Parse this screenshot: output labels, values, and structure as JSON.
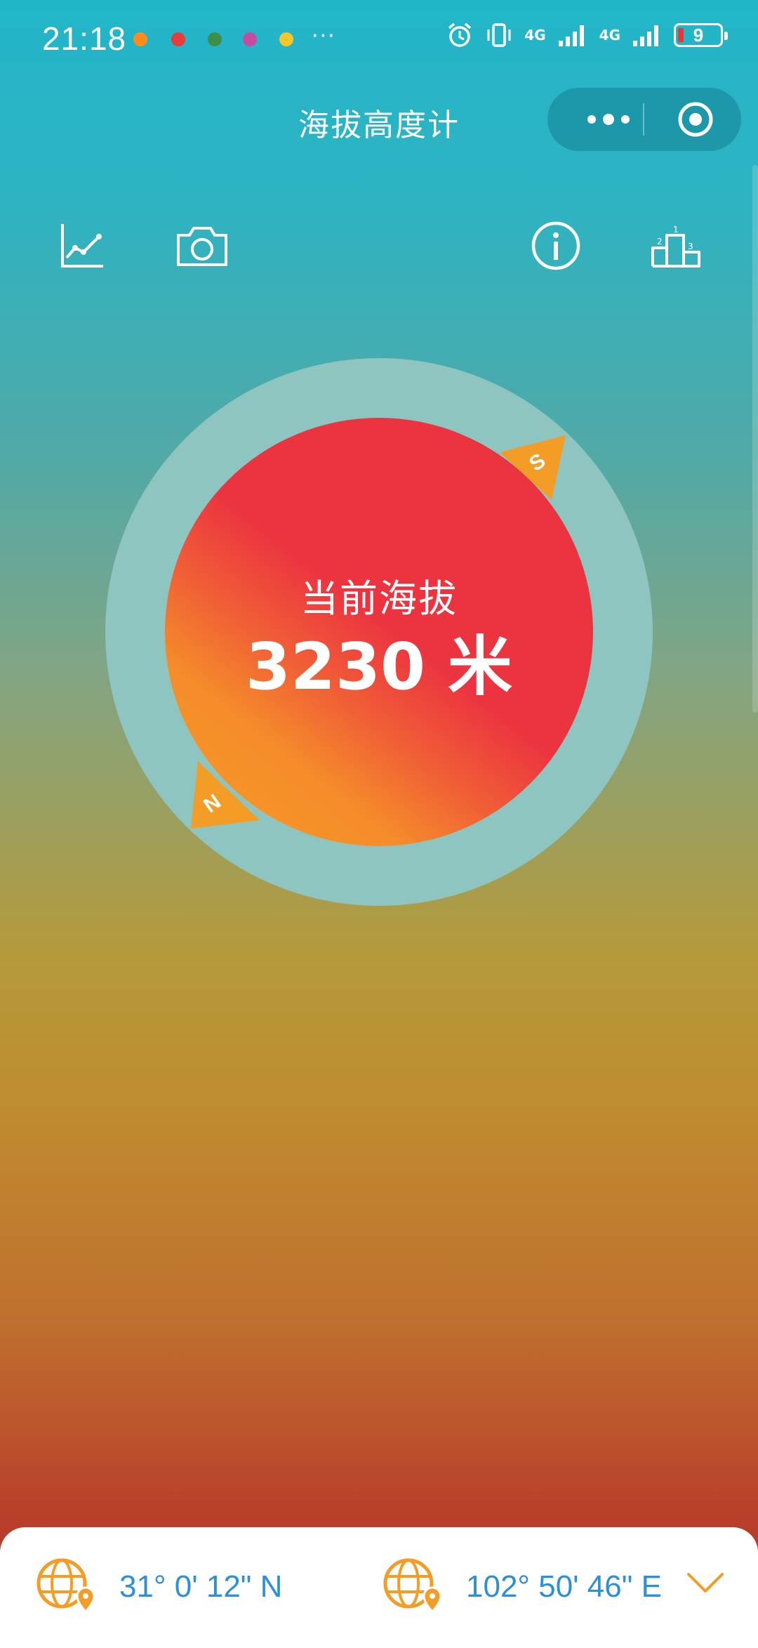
{
  "status_bar": {
    "time": "21:18",
    "more": "···",
    "network_1": "4G",
    "network_2": "4G",
    "battery": "9"
  },
  "header": {
    "title": "海拔高度计"
  },
  "toolbar": {
    "icons": [
      "chart-icon",
      "camera-icon",
      "info-icon",
      "ranking-icon"
    ]
  },
  "dial": {
    "label": "当前海拔",
    "value": "3230 米",
    "marker_south": "S",
    "marker_north": "N"
  },
  "coordinates": {
    "latitude": "31° 0' 12\" N",
    "longitude": "102° 50' 46\" E"
  },
  "colors": {
    "accent_orange": "#f39c26",
    "coord_text": "#2d8fd5",
    "dial_red": "#ec3340",
    "ring": "#8fc5c0"
  }
}
